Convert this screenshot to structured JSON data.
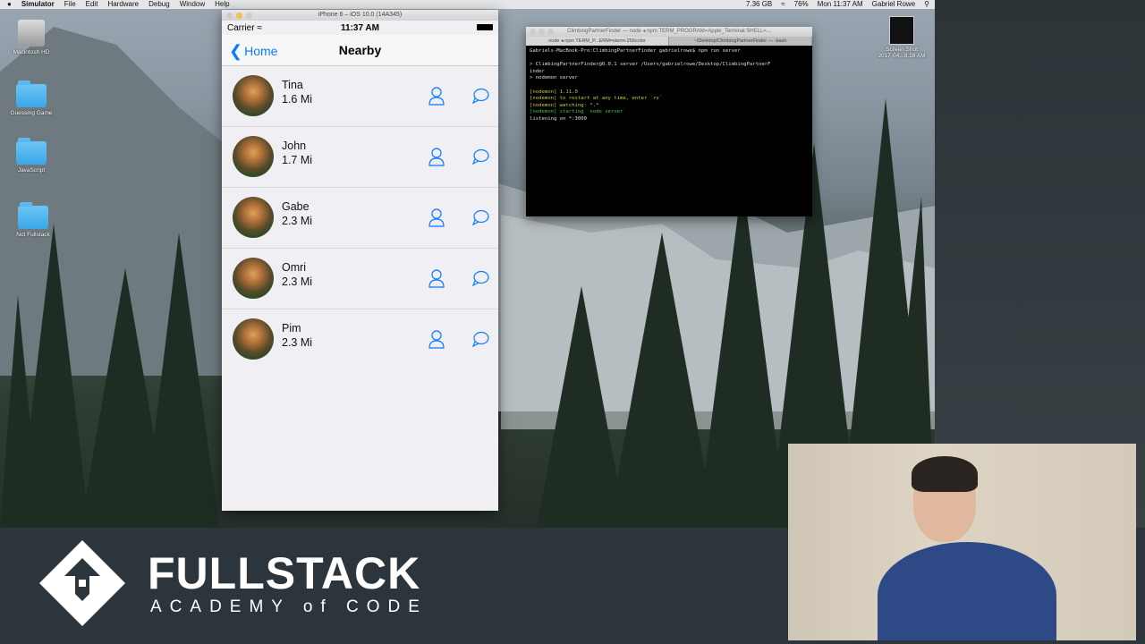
{
  "menubar": {
    "app": "Simulator",
    "items": [
      "File",
      "Edit",
      "Hardware",
      "Debug",
      "Window",
      "Help"
    ],
    "storage": "7.36 GB",
    "battery": "76%",
    "clock": "Mon 11:37 AM",
    "user": "Gabriel Rowe"
  },
  "desktop_icons": [
    {
      "label": "Macintosh HD",
      "icon": "hard-drive-icon"
    },
    {
      "label": "Guessing Game",
      "icon": "folder-icon"
    },
    {
      "label": "JavaScript",
      "icon": "folder-icon"
    },
    {
      "label": "Not Fullstack",
      "icon": "folder-icon"
    }
  ],
  "screenshot_icon": {
    "label1": "Screen Shot",
    "label2": "2017-04...8.16 AM"
  },
  "simulator": {
    "window_title": "iPhone 6 – iOS 10.0 (14A345)",
    "status": {
      "carrier": "Carrier",
      "time": "11:37 AM"
    },
    "nav": {
      "back": "Home",
      "title": "Nearby"
    },
    "rows": [
      {
        "name": "Tina",
        "distance": "1.6 Mi"
      },
      {
        "name": "John",
        "distance": "1.7 Mi"
      },
      {
        "name": "Gabe",
        "distance": "2.3 Mi"
      },
      {
        "name": "Omri",
        "distance": "2.3 Mi"
      },
      {
        "name": "Pim",
        "distance": "2.3 Mi"
      }
    ]
  },
  "terminal": {
    "title": "ClimbingPartnerFinder — node ◂ npm TERM_PROGRAM=Apple_Terminal SHELL=...",
    "tabs": [
      "node ◂ npm TERM_P...ERM=xterm-256color",
      "~/Desktop/ClimbingPartnerFinder — -bash"
    ],
    "lines": [
      {
        "text": "Gabriels-MacBook-Pro:ClimbingPartnerFinder gabrielrowe$ npm run server",
        "cls": ""
      },
      {
        "text": "",
        "cls": ""
      },
      {
        "text": "> ClimbingPartnerFinder@0.0.1 server /Users/gabrielrowe/Desktop/ClimbingPartnerF",
        "cls": ""
      },
      {
        "text": "inder",
        "cls": ""
      },
      {
        "text": "> nodemon server",
        "cls": ""
      },
      {
        "text": "",
        "cls": ""
      },
      {
        "text": "[nodemon] 1.11.0",
        "cls": "y"
      },
      {
        "text": "[nodemon] to restart at any time, enter `rs`",
        "cls": "y"
      },
      {
        "text": "[nodemon] watching: *.*",
        "cls": "y"
      },
      {
        "text": "[nodemon] starting `node server`",
        "cls": "g"
      },
      {
        "text": "listening on *:3000",
        "cls": ""
      }
    ]
  },
  "banner": {
    "line1": "FULLSTACK",
    "line2": "ACADEMY of CODE"
  },
  "colors": {
    "ios_blue": "#0a7aff",
    "list_bg": "#efeff4",
    "banner_bg": "#2c353b"
  }
}
